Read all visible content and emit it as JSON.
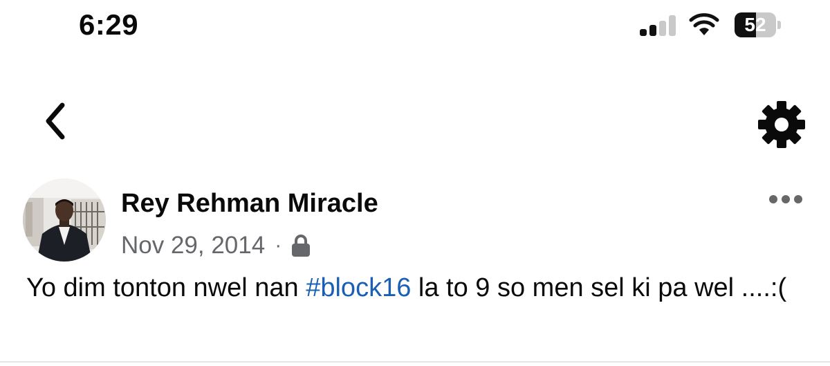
{
  "status_bar": {
    "time": "6:29",
    "battery_level": "52",
    "battery_fraction": 0.52,
    "signal_bars_active": 2,
    "signal_bars_total": 4,
    "icons": [
      "signal-icon",
      "wifi-icon",
      "battery-icon"
    ]
  },
  "nav": {
    "back_icon": "chevron-left-icon",
    "settings_icon": "gear-icon"
  },
  "post": {
    "author": "Rey Rehman Miracle",
    "date": "Nov 29, 2014",
    "separator": "·",
    "privacy_icon": "lock-icon",
    "more_icon": "more-horizontal-icon",
    "text_before": "Yo dim tonton nwel nan ",
    "hashtag": "#block16",
    "text_after": " la to 9 so men sel ki pa wel ....:("
  },
  "colors": {
    "text_primary": "#0a0a0a",
    "text_secondary": "#65676b",
    "link": "#1a5fb4",
    "background": "#ffffff"
  }
}
